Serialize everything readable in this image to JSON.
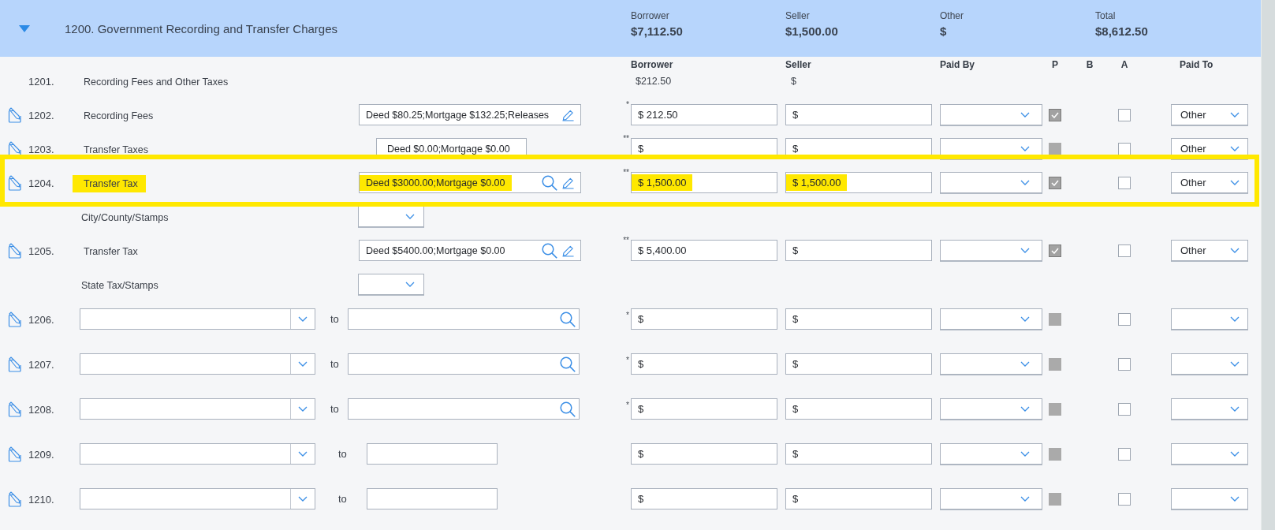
{
  "section": {
    "title": "1200. Government Recording and Transfer Charges",
    "expanded": true,
    "totals": [
      {
        "label": "Borrower",
        "value": "$7,112.50"
      },
      {
        "label": "Seller",
        "value": "$1,500.00"
      },
      {
        "label": "Other",
        "value": "$"
      },
      {
        "label": "Total",
        "value": "$8,612.50"
      }
    ]
  },
  "columns": [
    "Borrower",
    "Seller",
    "Paid By",
    "P",
    "B",
    "A",
    "Paid To"
  ],
  "rows": [
    {
      "kind": "summary",
      "number": "1201.",
      "label": "Recording Fees and Other Taxes",
      "borrower": "$212.50",
      "seller": "$",
      "highlighted": false
    },
    {
      "kind": "charge",
      "number": "1202.",
      "label": "Recording Fees",
      "details": {
        "value": "Deed $80.25;Mortgage $132.25;Releases",
        "search": false,
        "edit": true
      },
      "marker": "*",
      "borrower": "$ 212.50",
      "seller": "$",
      "p_checked": true,
      "a_checked": false,
      "paid_to": "Other",
      "highlighted": false
    },
    {
      "kind": "charge",
      "number": "1203.",
      "label": "Transfer Taxes",
      "details": {
        "value": "Deed $0.00;Mortgage $0.00",
        "search": false,
        "edit": false
      },
      "marker": "**",
      "borrower": "$",
      "seller": "$",
      "p_checked": false,
      "a_checked": false,
      "paid_to": "Other",
      "highlighted": false
    },
    {
      "kind": "charge",
      "number": "1204.",
      "label": "Transfer Tax",
      "details": {
        "value": "Deed $3000.00;Mortgage $0.00",
        "search": true,
        "edit": true
      },
      "marker": "**",
      "borrower": "$ 1,500.00",
      "seller": "$ 1,500.00",
      "p_checked": true,
      "a_checked": false,
      "paid_to": "Other",
      "highlighted": true,
      "sub_label": "City/County/Stamps"
    },
    {
      "kind": "charge",
      "number": "1205.",
      "label": "Transfer Tax",
      "details": {
        "value": "Deed $5400.00;Mortgage $0.00",
        "search": true,
        "edit": true
      },
      "marker": "**",
      "borrower": "$ 5,400.00",
      "seller": "$",
      "p_checked": true,
      "a_checked": false,
      "paid_to": "Other",
      "highlighted": false,
      "sub_label": "State Tax/Stamps"
    },
    {
      "kind": "custom",
      "number": "1206.",
      "to_label": "to",
      "payee_search": true,
      "marker": "*",
      "borrower": "$",
      "seller": "$",
      "p_checked": false,
      "a_checked": false,
      "highlighted": false
    },
    {
      "kind": "custom",
      "number": "1207.",
      "to_label": "to",
      "payee_search": true,
      "marker": "*",
      "borrower": "$",
      "seller": "$",
      "p_checked": false,
      "a_checked": false,
      "highlighted": false
    },
    {
      "kind": "custom",
      "number": "1208.",
      "to_label": "to",
      "payee_search": true,
      "marker": "*",
      "borrower": "$",
      "seller": "$",
      "p_checked": false,
      "a_checked": false,
      "highlighted": false
    },
    {
      "kind": "custom",
      "number": "1209.",
      "to_label": "to",
      "payee_search": false,
      "borrower": "$",
      "seller": "$",
      "p_checked": false,
      "a_checked": false,
      "highlighted": false
    },
    {
      "kind": "custom",
      "number": "1210.",
      "to_label": "to",
      "payee_search": false,
      "borrower": "$",
      "seller": "$",
      "p_checked": false,
      "a_checked": false,
      "highlighted": false
    }
  ]
}
